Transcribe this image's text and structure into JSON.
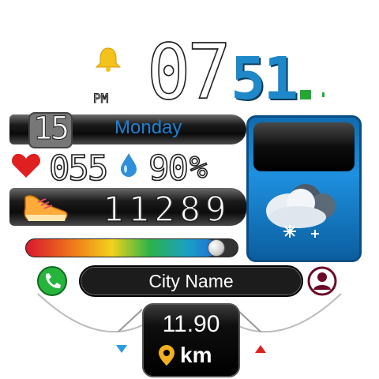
{
  "time": {
    "hours": "07",
    "minutes": "51",
    "ampm": "PM"
  },
  "date": {
    "day": "15",
    "weekday": "Monday"
  },
  "health": {
    "heart_rate": "055",
    "humidity": "90",
    "humidity_unit": "%",
    "steps": "11289"
  },
  "progress": {
    "steps_goal_fraction": 0.9
  },
  "city": {
    "name": "City Name"
  },
  "distance": {
    "value": "11.90",
    "unit": "km"
  },
  "colors": {
    "minutes": "#1e88c8",
    "weekday": "#1e7fd6",
    "battery": "#22a833",
    "accent_red": "#e02020"
  },
  "icons": [
    "bell-icon",
    "battery-icon",
    "heart-icon",
    "water-drop-icon",
    "sneaker-icon",
    "weather-snow-icon",
    "phone-icon",
    "user-icon",
    "location-pin-icon",
    "arrow-down-icon",
    "arrow-up-icon"
  ]
}
